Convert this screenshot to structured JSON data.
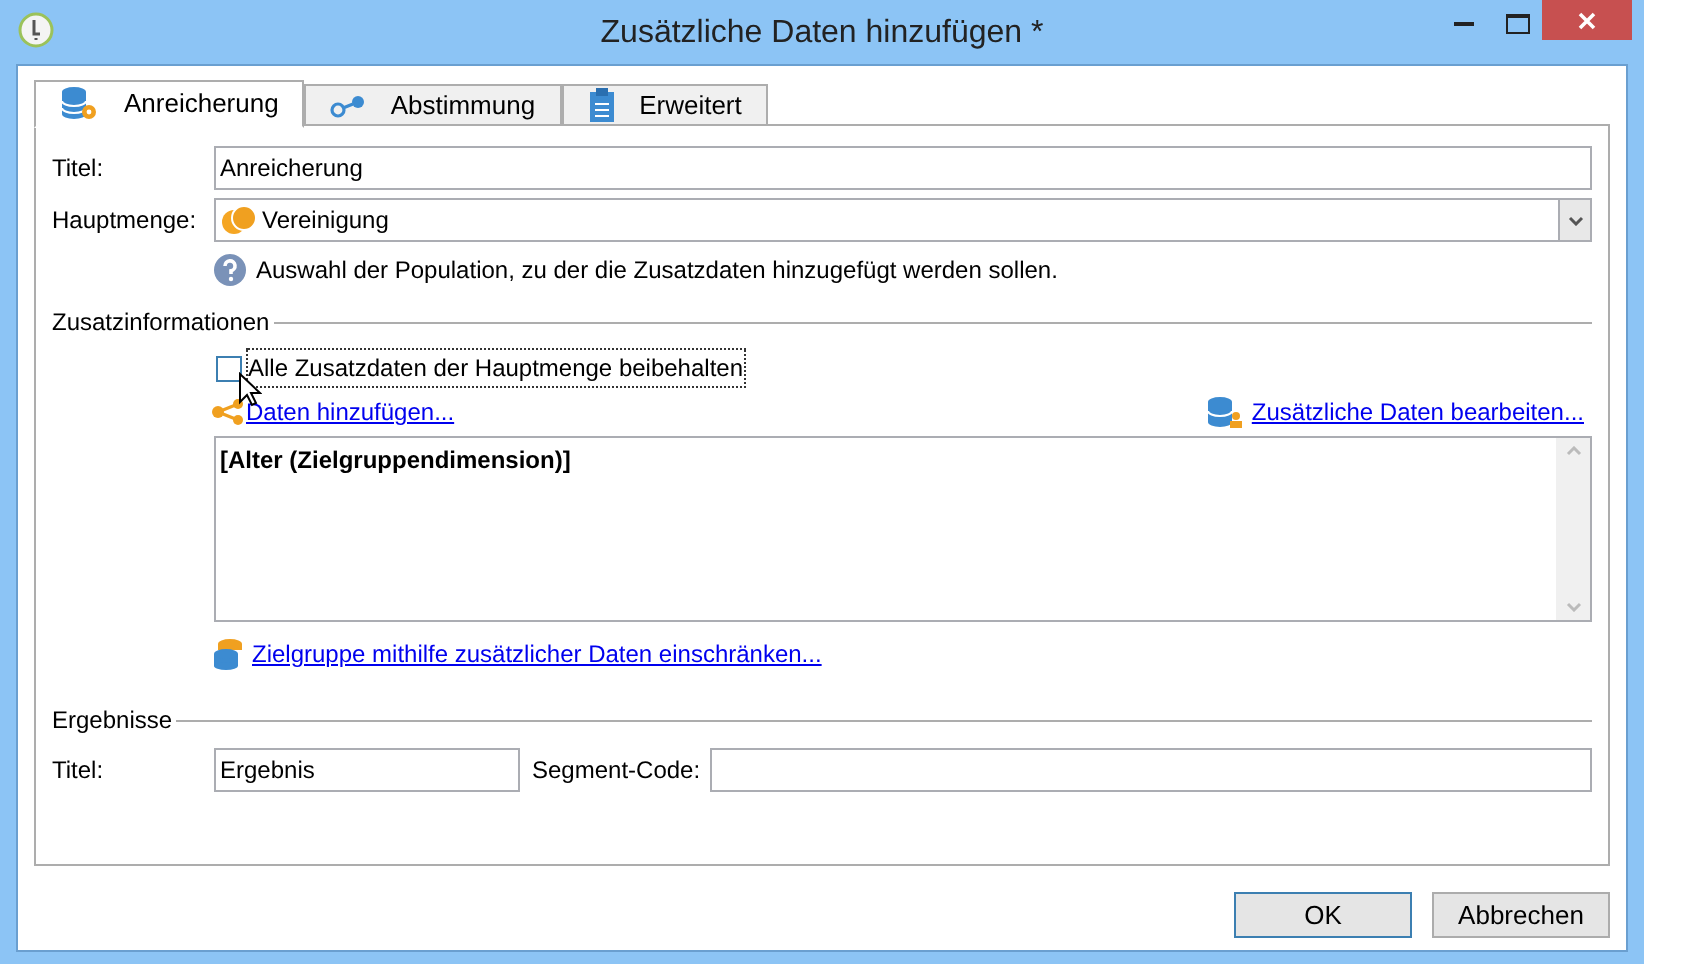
{
  "window": {
    "title": "Zusätzliche Daten hinzufügen *"
  },
  "tabs": [
    {
      "label": "Anreicherung",
      "selected": true,
      "kind": "enrich"
    },
    {
      "label": "Abstimmung",
      "selected": false,
      "kind": "link"
    },
    {
      "label": "Erweitert",
      "selected": false,
      "kind": "clipboard"
    }
  ],
  "form": {
    "title_label": "Titel:",
    "title_value": "Anreicherung",
    "main_set_label": "Hauptmenge:",
    "main_set_value": "Vereinigung",
    "hint": "Auswahl der Population, zu der die Zusatzdaten hinzugefügt werden sollen."
  },
  "additional_info": {
    "heading": "Zusatzinformationen",
    "keep_all": {
      "label": "Alle Zusatzdaten der Hauptmenge beibehalten",
      "checked": false
    },
    "add_link": "Daten hinzufügen...",
    "edit_link": "Zusätzliche Daten bearbeiten...",
    "items": [
      "[Alter (Zielgruppendimension)]"
    ],
    "restrict_link": "Zielgruppe mithilfe zusätzlicher Daten einschränken..."
  },
  "results": {
    "heading": "Ergebnisse",
    "title_label": "Titel:",
    "title_value": "Ergebnis",
    "segment_label": "Segment-Code:"
  },
  "buttons": [
    {
      "label": "OK",
      "default": true
    },
    {
      "label": "Abbrechen",
      "default": false
    }
  ]
}
